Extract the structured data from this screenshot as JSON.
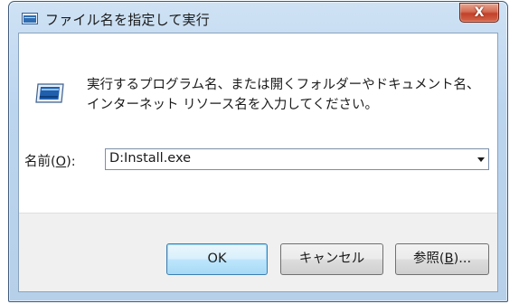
{
  "window": {
    "title": "ファイル名を指定して実行",
    "close_glyph": "X"
  },
  "dialog": {
    "description": "実行するプログラム名、または開くフォルダーやドキュメント名、インターネット リソース名を入力してください。",
    "open_label_prefix": "名前(",
    "open_label_accel": "O",
    "open_label_suffix": "):",
    "open_value": "D:Install.exe"
  },
  "buttons": {
    "ok": "OK",
    "cancel": "キャンセル",
    "browse_prefix": "参照(",
    "browse_accel": "B",
    "browse_suffix": ")..."
  },
  "icons": {
    "title": "run-window-icon",
    "body": "run-window-icon",
    "close": "close-icon",
    "dropdown": "chevron-down-icon"
  },
  "colors": {
    "title_bar": "#bcd5ef",
    "close_button": "#c2412a",
    "ok_button_border": "#3c7fb1",
    "footer_background": "#f0f0f0"
  }
}
